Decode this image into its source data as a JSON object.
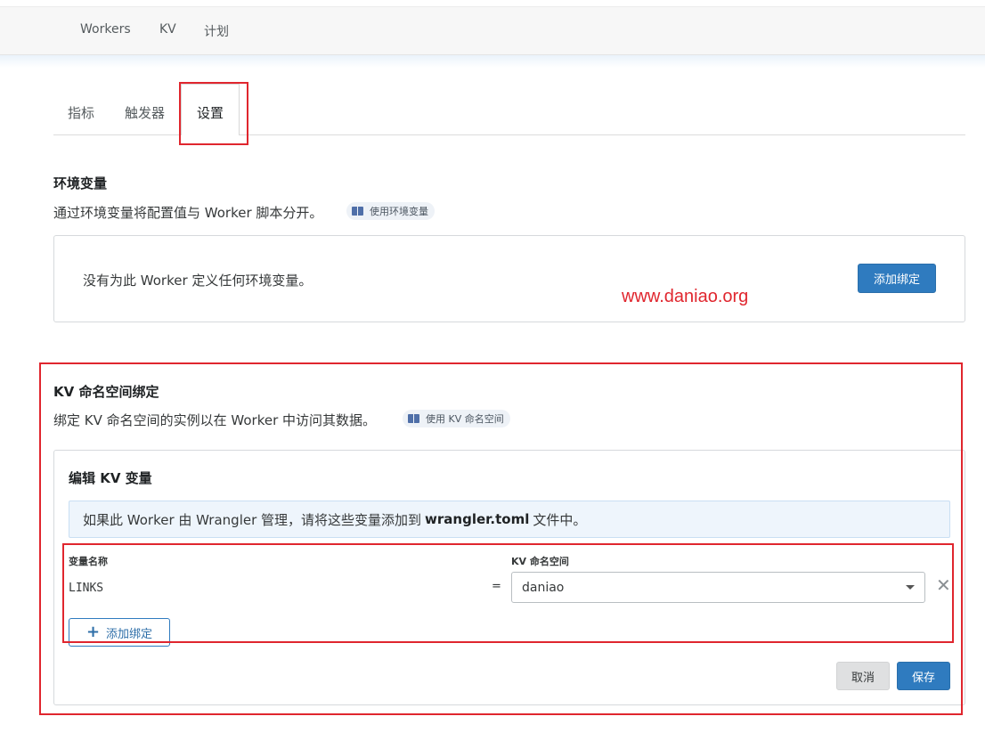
{
  "topnav": {
    "items": [
      "Workers",
      "KV",
      "计划"
    ]
  },
  "tabs": [
    {
      "label": "指标",
      "active": false
    },
    {
      "label": "触发器",
      "active": false
    },
    {
      "label": "设置",
      "active": true
    }
  ],
  "env": {
    "title": "环境变量",
    "description": "通过环境变量将配置值与 Worker 脚本分开。",
    "doc_link": "使用环境变量",
    "empty_text": "没有为此 Worker 定义任何环境变量。",
    "add_button": "添加绑定"
  },
  "watermark": "www.daniao.org",
  "kv": {
    "title": "KV 命名空间绑定",
    "description": "绑定 KV 命名空间的实例以在 Worker 中访问其数据。",
    "doc_link": "使用 KV 命名空间",
    "edit": {
      "title": "编辑 KV 变量",
      "info_prefix": "如果此 Worker 由 Wrangler 管理，请将这些变量添加到",
      "info_file": "wrangler.toml",
      "info_suffix": "文件中。",
      "var_label": "变量名称",
      "ns_label": "KV 命名空间",
      "var_value": "LINKS",
      "equals": "=",
      "ns_value": "daniao",
      "add_binding": "添加绑定",
      "cancel": "取消",
      "save": "保存"
    }
  },
  "colors": {
    "primary": "#2f7bbf",
    "highlight": "#e0262e",
    "info_bg": "#eef5fc"
  },
  "icons": {
    "doc": "book-icon",
    "add": "plus-icon",
    "remove": "close-icon",
    "dropdown": "caret-down-icon"
  }
}
